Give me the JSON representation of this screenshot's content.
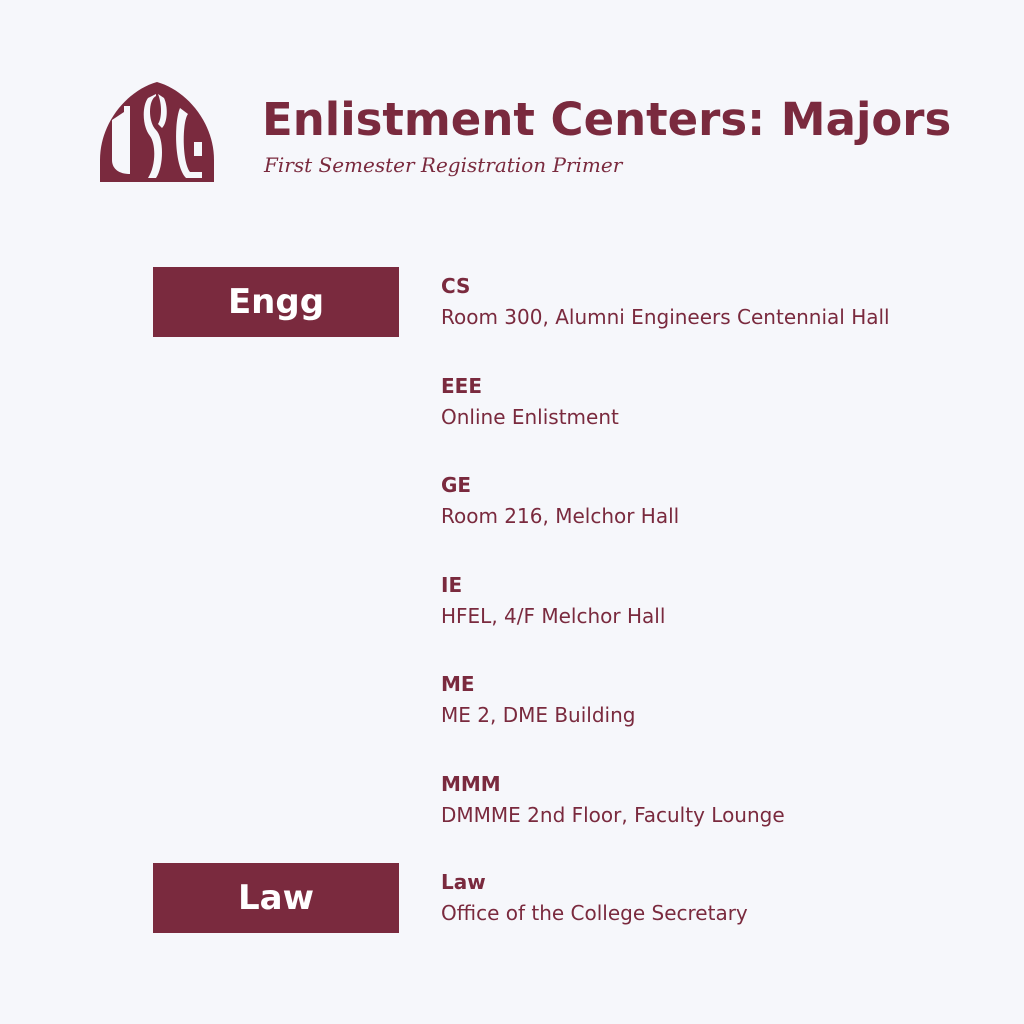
{
  "header": {
    "title": "Enlistment Centers: Majors",
    "subtitle": "First Semester Registration Primer",
    "logo_text": "USC"
  },
  "colors": {
    "brand": "#7a2a3e",
    "background": "#f6f7fb",
    "tag_text": "#ffffff"
  },
  "categories": [
    {
      "label": "Engg",
      "entries": [
        {
          "code": "CS",
          "location": "Room 300, Alumni Engineers Centennial Hall"
        },
        {
          "code": "EEE",
          "location": "Online Enlistment"
        },
        {
          "code": "GE",
          "location": "Room 216, Melchor Hall"
        },
        {
          "code": "IE",
          "location": "HFEL, 4/F Melchor Hall"
        },
        {
          "code": "ME",
          "location": "ME 2, DME Building"
        },
        {
          "code": "MMM",
          "location": "DMMME 2nd Floor, Faculty Lounge"
        }
      ]
    },
    {
      "label": "Law",
      "entries": [
        {
          "code": "Law",
          "location": "Office of the College Secretary"
        }
      ]
    }
  ]
}
